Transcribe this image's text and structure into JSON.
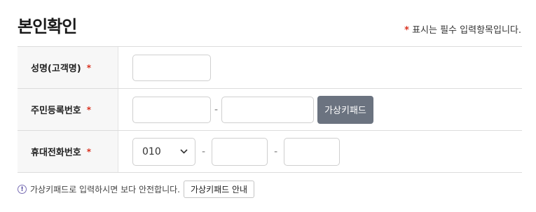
{
  "header": {
    "title": "본인확인",
    "required_star": "*",
    "required_note": "표시는 필수 입력항목입니다."
  },
  "form": {
    "name_row": {
      "label": "성명(고객명)",
      "star": "*",
      "value": ""
    },
    "rrn_row": {
      "label": "주민등록번호",
      "star": "*",
      "first_value": "",
      "separator": "-",
      "second_value": "",
      "virtual_keypad_label": "가상키패드"
    },
    "phone_row": {
      "label": "휴대전화번호",
      "star": "*",
      "prefix_selected": "010",
      "separator1": "-",
      "middle_value": "",
      "separator2": "-",
      "last_value": ""
    }
  },
  "footer": {
    "info_icon_glyph": "!",
    "note": "가상키패드로 입력하시면 보다 안전합니다.",
    "guide_button_label": "가상키패드 안내"
  },
  "colors": {
    "required_star": "#d9301e",
    "keypad_button_bg": "#6b7380",
    "label_cell_bg": "#f7f7f7"
  }
}
